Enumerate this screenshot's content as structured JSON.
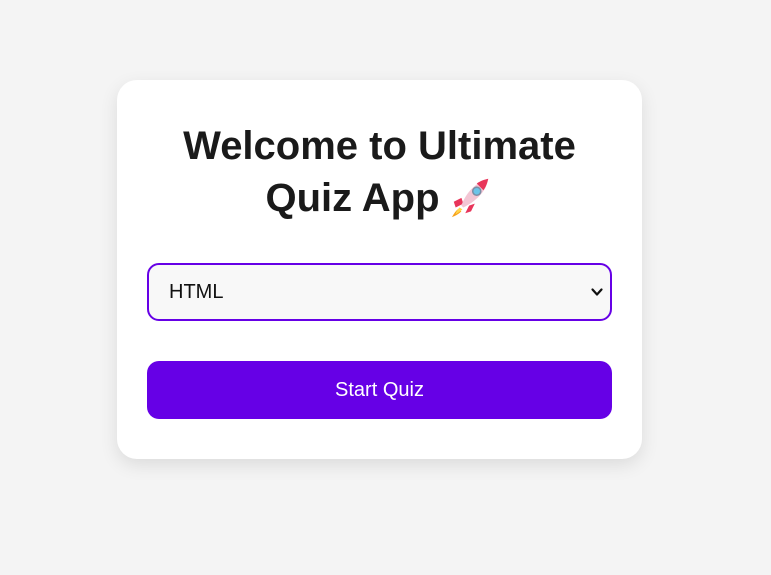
{
  "welcome": {
    "title_line1": "Welcome to Ultimate",
    "title_line2": "Quiz App",
    "title_icon": "rocket-icon"
  },
  "topic_select": {
    "selected": "HTML",
    "icon": "chevron-down-icon"
  },
  "start_button": {
    "label": "Start Quiz"
  },
  "colors": {
    "accent": "#6600e6",
    "background": "#f4f4f4",
    "card": "#ffffff"
  }
}
